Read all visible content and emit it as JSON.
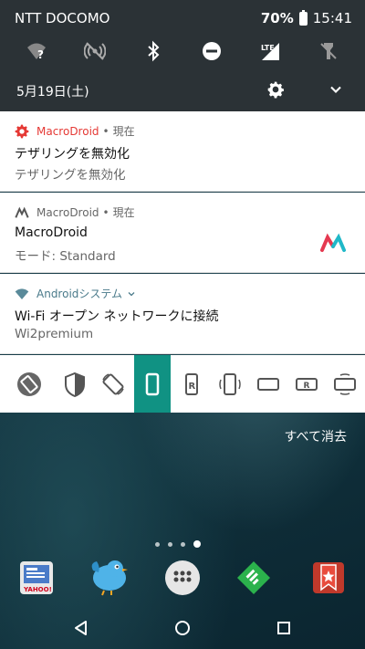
{
  "status_bar": {
    "carrier": "NTT DOCOMO",
    "battery": "70%",
    "time": "15:41",
    "lte_label": "LTE"
  },
  "quick_settings": {
    "date": "5月19日(土)",
    "tiles": [
      "wifi-unknown-icon",
      "hotspot-off-icon",
      "bluetooth-icon",
      "do-not-disturb-icon",
      "mobile-data-icon",
      "flashlight-off-icon"
    ]
  },
  "notifications": [
    {
      "app": "MacroDroid",
      "time_sep": "•",
      "time": "現在",
      "title": "テザリングを無効化",
      "text": "テザリングを無効化",
      "accent": "#e53935"
    },
    {
      "app": "MacroDroid",
      "time_sep": "•",
      "time": "現在",
      "title": "MacroDroid",
      "text": "モード: Standard"
    },
    {
      "app": "Androidシステム",
      "title": "Wi-Fi オープン ネットワークに接続",
      "text": "Wi2premium"
    }
  ],
  "rotation_bar": {
    "selected_index": 3,
    "selected_color": "#109283",
    "buttons": [
      "auto-rotate",
      "rotation-shield",
      "rotate",
      "portrait",
      "portrait-reverse",
      "portrait-sensor",
      "landscape",
      "landscape-reverse",
      "landscape-sensor"
    ],
    "reverse_label": "R"
  },
  "home": {
    "clear_all": "すべて消去",
    "dock_apps": [
      "yahoo-news-icon",
      "twitter-bird-icon",
      "app-drawer-icon",
      "feedly-icon",
      "bookmark-app-icon"
    ],
    "yahoo_label": "YAHOO!"
  }
}
